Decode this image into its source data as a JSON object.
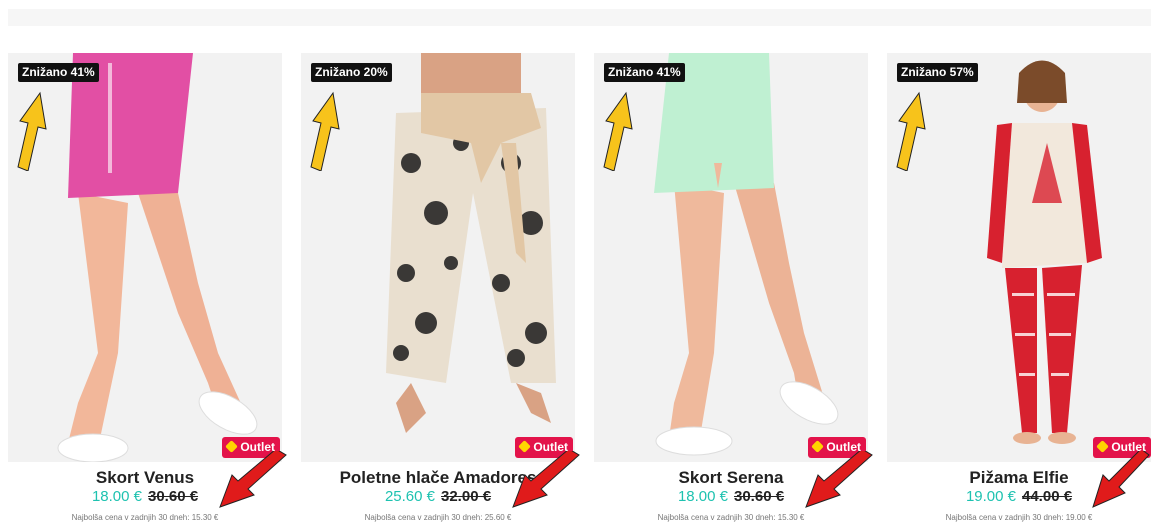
{
  "products": [
    {
      "badge": "Znižano 41%",
      "outlet": "Outlet",
      "name": "Skort Venus",
      "price": "18.00 €",
      "old_price": "30.60 €",
      "lowest": "Najbolša cena v zadnjih 30 dneh: 15.30 €",
      "garment": "#e24fa4",
      "garment2": "#d2398f"
    },
    {
      "badge": "Znižano 20%",
      "outlet": "Outlet",
      "name": "Poletne hlače Amadores",
      "price": "25.60 €",
      "old_price": "32.00 €",
      "lowest": "Najbolša cena v zadnjih 30 dneh: 25.60 €",
      "garment": "#e9dfcf",
      "garment2": "#1c1c1c"
    },
    {
      "badge": "Znižano 41%",
      "outlet": "Outlet",
      "name": "Skort Serena",
      "price": "18.00 €",
      "old_price": "30.60 €",
      "lowest": "Najbolša cena v zadnjih 30 dneh: 15.30 €",
      "garment": "#bff0d2",
      "garment2": "#a8e2c0"
    },
    {
      "badge": "Znižano 57%",
      "outlet": "Outlet",
      "name": "Pižama Elfie",
      "price": "19.00 €",
      "old_price": "44.00 €",
      "lowest": "Najbolša cena v zadnjih 30 dneh: 19.00 €",
      "garment": "#d7212f",
      "garment2": "#f2e8dc"
    }
  ],
  "colors": {
    "accent": "#1ec2b0",
    "outlet": "#e3134a",
    "arrow_up": "#f7c31b",
    "arrow_down": "#e01b1b"
  }
}
